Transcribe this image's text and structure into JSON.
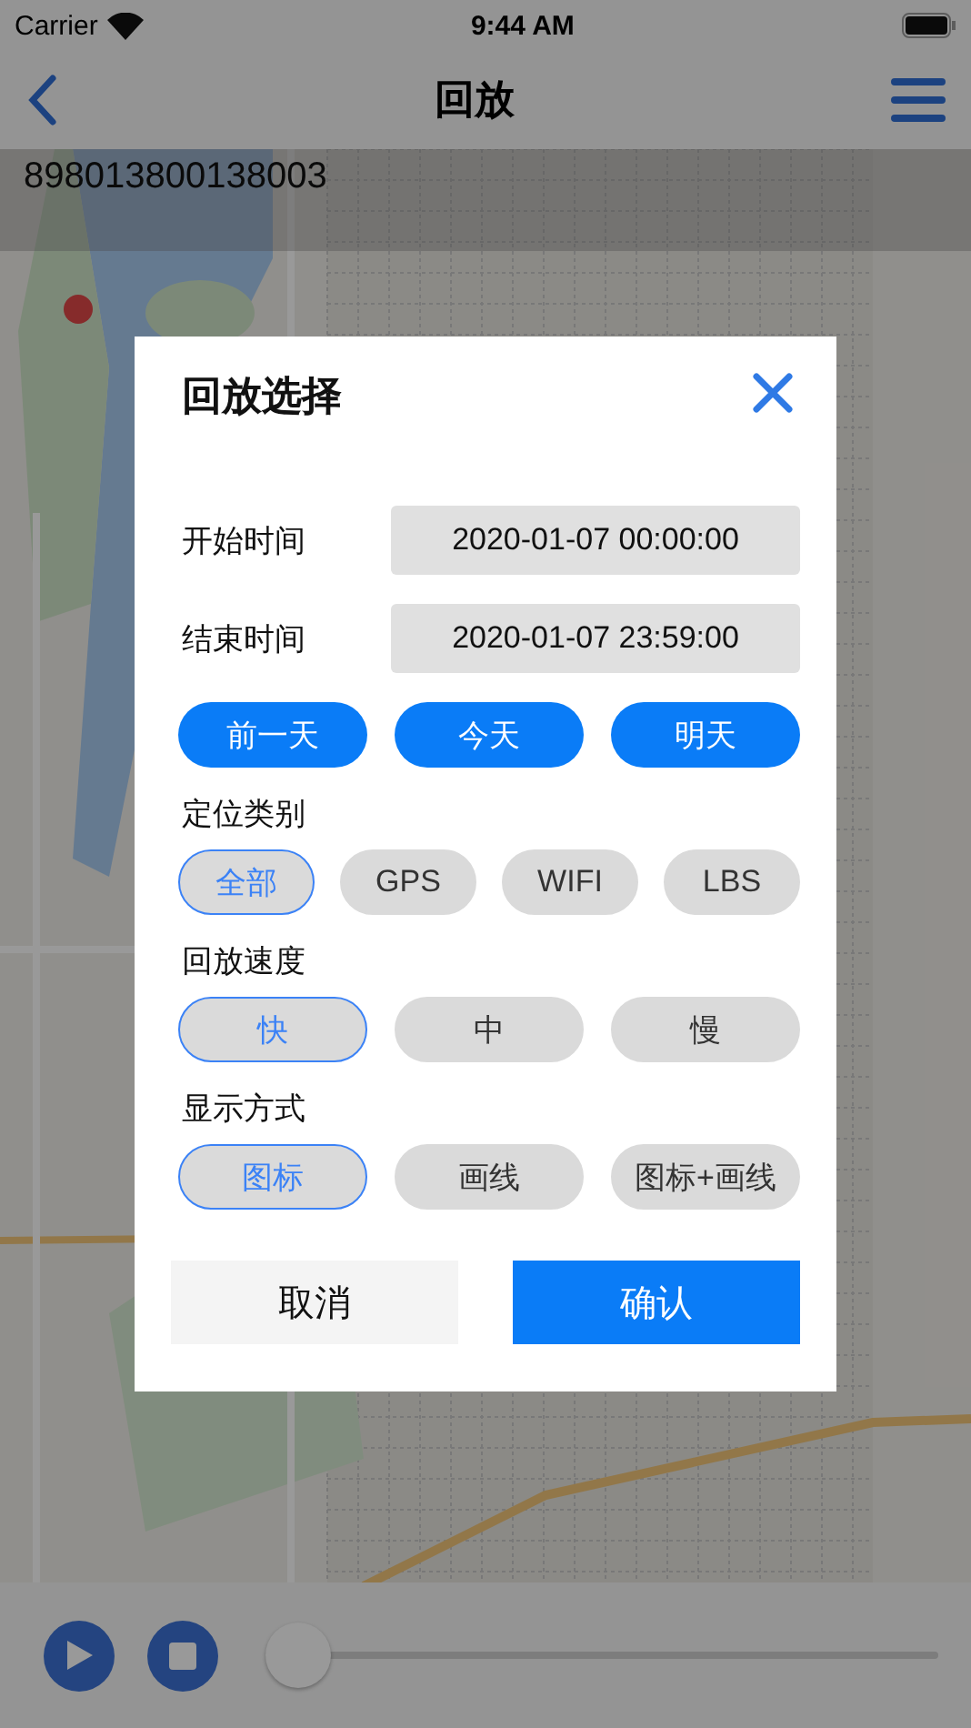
{
  "status_bar": {
    "carrier": "Carrier",
    "time": "9:44 AM"
  },
  "nav": {
    "title": "回放"
  },
  "device_id": "898013800138003",
  "dialog": {
    "title": "回放选择",
    "times": [
      {
        "label": "开始时间",
        "value": "2020-01-07 00:00:00"
      },
      {
        "label": "结束时间",
        "value": "2020-01-07 23:59:00"
      }
    ],
    "day_buttons": [
      "前一天",
      "今天",
      "明天"
    ],
    "groups": [
      {
        "title": "定位类别",
        "options": [
          {
            "label": "全部",
            "selected": true
          },
          {
            "label": "GPS",
            "selected": false
          },
          {
            "label": "WIFI",
            "selected": false
          },
          {
            "label": "LBS",
            "selected": false
          }
        ]
      },
      {
        "title": "回放速度",
        "options": [
          {
            "label": "快",
            "selected": true
          },
          {
            "label": "中",
            "selected": false
          },
          {
            "label": "慢",
            "selected": false
          }
        ]
      },
      {
        "title": "显示方式",
        "options": [
          {
            "label": "图标",
            "selected": true
          },
          {
            "label": "画线",
            "selected": false
          },
          {
            "label": "图标+画线",
            "selected": false
          }
        ]
      }
    ],
    "cancel": "取消",
    "confirm": "确认"
  },
  "playback": {
    "level": 0
  }
}
